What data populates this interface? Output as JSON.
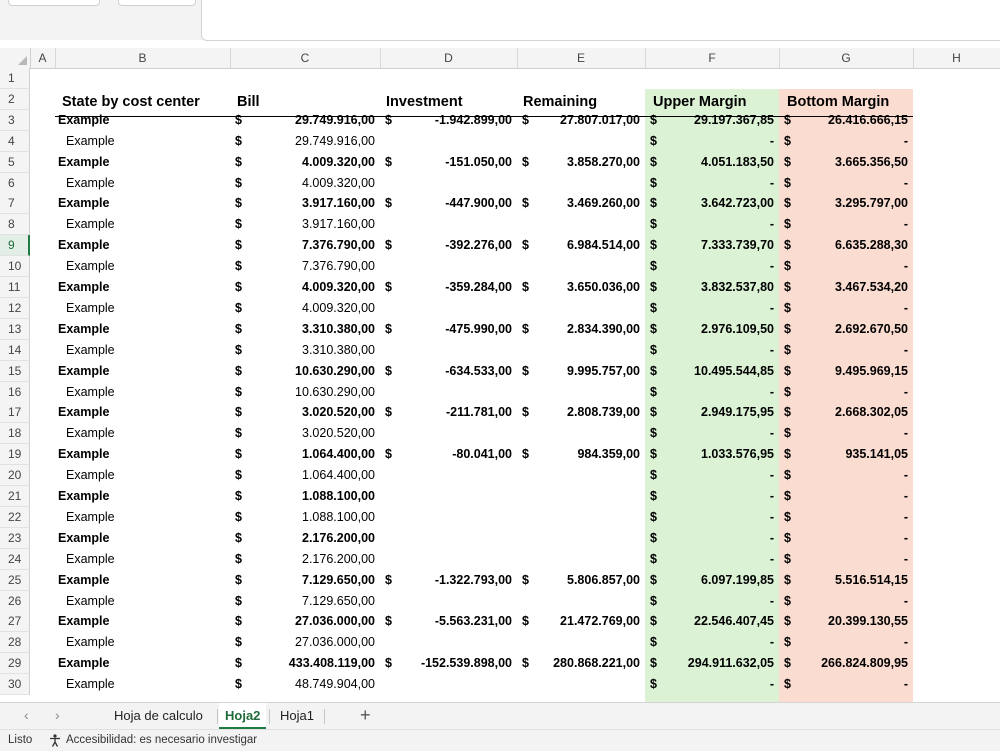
{
  "columns": [
    "A",
    "B",
    "C",
    "D",
    "E",
    "F",
    "G",
    "H"
  ],
  "rows": [
    "1",
    "2",
    "3",
    "4",
    "5",
    "6",
    "7",
    "8",
    "9",
    "10",
    "11",
    "12",
    "13",
    "14",
    "15",
    "16",
    "17",
    "18",
    "19",
    "20",
    "21",
    "22",
    "23",
    "24",
    "25",
    "26",
    "27",
    "28",
    "29",
    "30"
  ],
  "active_row": "9",
  "currency_symbol": "$",
  "headers": {
    "state": "State by cost center",
    "bill": "Bill",
    "investment": "Investment",
    "remaining": "Remaining",
    "upper": "Upper Margin",
    "bottom": "Bottom Margin"
  },
  "table": [
    {
      "label": "Example",
      "bold": true,
      "bill": "29.749.916,00",
      "inv": "-1.942.899,00",
      "rem": "27.807.017,00",
      "upper": "29.197.367,85",
      "bottom": "26.416.666,15"
    },
    {
      "label": "Example",
      "bold": false,
      "bill": "29.749.916,00",
      "upper": "-",
      "bottom": "-"
    },
    {
      "label": "Example",
      "bold": true,
      "bill": "4.009.320,00",
      "inv": "-151.050,00",
      "rem": "3.858.270,00",
      "upper": "4.051.183,50",
      "bottom": "3.665.356,50"
    },
    {
      "label": "Example",
      "bold": false,
      "bill": "4.009.320,00",
      "upper": "-",
      "bottom": "-"
    },
    {
      "label": "Example",
      "bold": true,
      "bill": "3.917.160,00",
      "inv": "-447.900,00",
      "rem": "3.469.260,00",
      "upper": "3.642.723,00",
      "bottom": "3.295.797,00"
    },
    {
      "label": "Example",
      "bold": false,
      "bill": "3.917.160,00",
      "upper": "-",
      "bottom": "-"
    },
    {
      "label": "Example",
      "bold": true,
      "bill": "7.376.790,00",
      "inv": "-392.276,00",
      "rem": "6.984.514,00",
      "upper": "7.333.739,70",
      "bottom": "6.635.288,30"
    },
    {
      "label": "Example",
      "bold": false,
      "bill": "7.376.790,00",
      "upper": "-",
      "bottom": "-"
    },
    {
      "label": "Example",
      "bold": true,
      "bill": "4.009.320,00",
      "inv": "-359.284,00",
      "rem": "3.650.036,00",
      "upper": "3.832.537,80",
      "bottom": "3.467.534,20"
    },
    {
      "label": "Example",
      "bold": false,
      "bill": "4.009.320,00",
      "upper": "-",
      "bottom": "-"
    },
    {
      "label": "Example",
      "bold": true,
      "bill": "3.310.380,00",
      "inv": "-475.990,00",
      "rem": "2.834.390,00",
      "upper": "2.976.109,50",
      "bottom": "2.692.670,50"
    },
    {
      "label": "Example",
      "bold": false,
      "bill": "3.310.380,00",
      "upper": "-",
      "bottom": "-"
    },
    {
      "label": "Example",
      "bold": true,
      "bill": "10.630.290,00",
      "inv": "-634.533,00",
      "rem": "9.995.757,00",
      "upper": "10.495.544,85",
      "bottom": "9.495.969,15"
    },
    {
      "label": "Example",
      "bold": false,
      "bill": "10.630.290,00",
      "upper": "-",
      "bottom": "-"
    },
    {
      "label": "Example",
      "bold": true,
      "bill": "3.020.520,00",
      "inv": "-211.781,00",
      "rem": "2.808.739,00",
      "upper": "2.949.175,95",
      "bottom": "2.668.302,05"
    },
    {
      "label": "Example",
      "bold": false,
      "bill": "3.020.520,00",
      "upper": "-",
      "bottom": "-"
    },
    {
      "label": "Example",
      "bold": true,
      "bill": "1.064.400,00",
      "inv": "-80.041,00",
      "rem": "984.359,00",
      "upper": "1.033.576,95",
      "bottom": "935.141,05"
    },
    {
      "label": "Example",
      "bold": false,
      "bill": "1.064.400,00",
      "upper": "-",
      "bottom": "-"
    },
    {
      "label": "Example",
      "bold": true,
      "bill": "1.088.100,00",
      "upper": "-",
      "bottom": "-"
    },
    {
      "label": "Example",
      "bold": false,
      "bill": "1.088.100,00",
      "upper": "-",
      "bottom": "-"
    },
    {
      "label": "Example",
      "bold": true,
      "bill": "2.176.200,00",
      "upper": "-",
      "bottom": "-"
    },
    {
      "label": "Example",
      "bold": false,
      "bill": "2.176.200,00",
      "upper": "-",
      "bottom": "-"
    },
    {
      "label": "Example",
      "bold": true,
      "bill": "7.129.650,00",
      "inv": "-1.322.793,00",
      "rem": "5.806.857,00",
      "upper": "6.097.199,85",
      "bottom": "5.516.514,15"
    },
    {
      "label": "Example",
      "bold": false,
      "bill": "7.129.650,00",
      "upper": "-",
      "bottom": "-"
    },
    {
      "label": "Example",
      "bold": true,
      "bill": "27.036.000,00",
      "inv": "-5.563.231,00",
      "rem": "21.472.769,00",
      "upper": "22.546.407,45",
      "bottom": "20.399.130,55"
    },
    {
      "label": "Example",
      "bold": false,
      "bill": "27.036.000,00",
      "upper": "-",
      "bottom": "-"
    },
    {
      "label": "Example",
      "bold": true,
      "bill": "433.408.119,00",
      "inv": "-152.539.898,00",
      "rem": "280.868.221,00",
      "upper": "294.911.632,05",
      "bottom": "266.824.809,95"
    },
    {
      "label": "Example",
      "bold": false,
      "bill": "48.749.904,00",
      "upper": "-",
      "bottom": "-"
    }
  ],
  "sheet_tabs": {
    "prev": "‹",
    "next": "›",
    "tabs": [
      "Hoja de calculo",
      "Hoja2",
      "Hoja1"
    ],
    "active": "Hoja2",
    "add": "+"
  },
  "status": {
    "mode": "Listo",
    "accessibility": "Accesibilidad: es necesario investigar"
  }
}
